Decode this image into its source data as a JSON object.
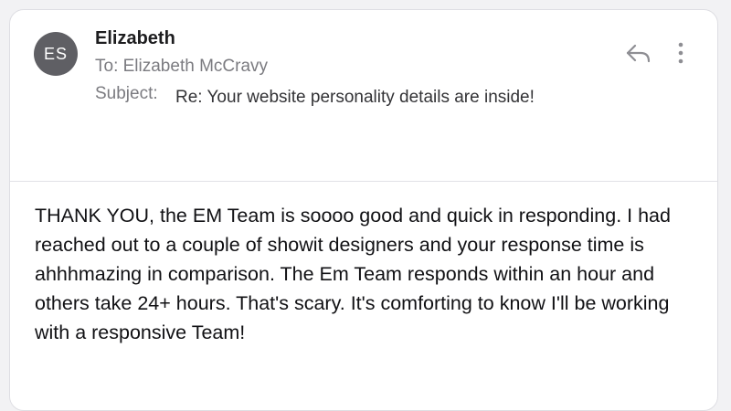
{
  "message": {
    "avatar_initials": "ES",
    "sender": "Elizabeth",
    "to_line": "To: Elizabeth McCravy",
    "subject_label": "Subject:",
    "subject": "Re: Your website personality details are inside!",
    "body": "THANK YOU, the EM Team is soooo good and quick in responding.  I had reached out to a couple of showit designers and your response time is ahhhmazing in comparison.  The Em Team responds within an hour and others take 24+ hours.  That's scary.  It's comforting to know I'll be working with a responsive Team!"
  },
  "icons": {
    "reply": "reply-icon",
    "more": "more-vertical-icon"
  },
  "colors": {
    "avatar_bg": "#5f5f64",
    "secondary_text": "#7b7b80",
    "icon": "#8e8e93"
  }
}
